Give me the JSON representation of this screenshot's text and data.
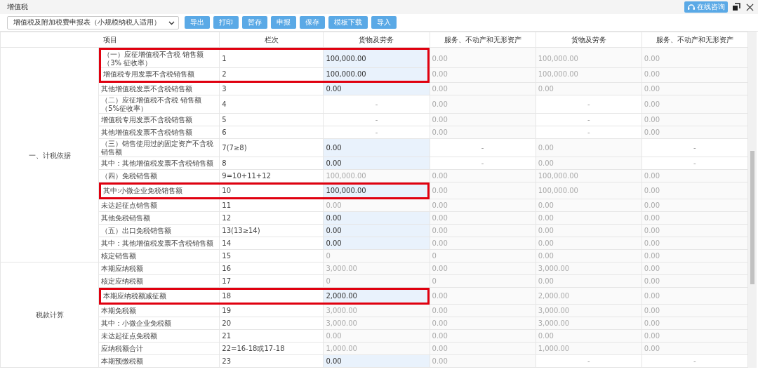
{
  "window": {
    "title": "增值税",
    "consult_button": "在线咨询"
  },
  "toolbar": {
    "report_select": {
      "value": "增值税及附加税费申报表（小规模纳税人适用）"
    },
    "buttons": [
      "导出",
      "打印",
      "暂存",
      "申报",
      "保存",
      "模板下载",
      "导入"
    ]
  },
  "table": {
    "columns": [
      "项目",
      "栏次",
      "货物及劳务",
      "服务、不动产和无形资产",
      "货物及劳务",
      "服务、不动产和无形资产"
    ],
    "sections": [
      {
        "label": "一、计税依据",
        "rows": [
          {
            "item": "（一）应征增值税不含税 销售额（3% 征收率）",
            "line": "1",
            "highlighted": true,
            "cells": [
              {
                "value": "100,000.00",
                "kind": "input"
              },
              {
                "value": "0.00",
                "kind": "readonly"
              },
              {
                "value": "100,000.00",
                "kind": "readonly"
              },
              {
                "value": "0.00",
                "kind": "readonly"
              }
            ]
          },
          {
            "item": "增值税专用发票不含税销售额",
            "line": "2",
            "highlighted": true,
            "cells": [
              {
                "value": "100,000.00",
                "kind": "input"
              },
              {
                "value": "0.00",
                "kind": "readonly"
              },
              {
                "value": "100,000.00",
                "kind": "readonly"
              },
              {
                "value": "0.00",
                "kind": "readonly"
              }
            ]
          },
          {
            "item": "其他增值税发票不含税销售额",
            "line": "3",
            "highlighted": false,
            "cells": [
              {
                "value": "0.00",
                "kind": "input"
              },
              {
                "value": "0.00",
                "kind": "readonly"
              },
              {
                "value": "0.00",
                "kind": "readonly"
              },
              {
                "value": "0.00",
                "kind": "readonly"
              }
            ]
          },
          {
            "item": "（二）应征增值税不含税 销售额（5%征收率）",
            "line": "4",
            "highlighted": false,
            "cells": [
              {
                "value": "-",
                "kind": "dash"
              },
              {
                "value": "0.00",
                "kind": "readonly"
              },
              {
                "value": "-",
                "kind": "dash"
              },
              {
                "value": "0.00",
                "kind": "readonly"
              }
            ]
          },
          {
            "item": "增值税专用发票不含税销售额",
            "line": "5",
            "highlighted": false,
            "cells": [
              {
                "value": "-",
                "kind": "dash"
              },
              {
                "value": "0.00",
                "kind": "readonly"
              },
              {
                "value": "-",
                "kind": "dash"
              },
              {
                "value": "0.00",
                "kind": "readonly"
              }
            ]
          },
          {
            "item": "其他增值税发票不含税销售额",
            "line": "6",
            "highlighted": false,
            "cells": [
              {
                "value": "-",
                "kind": "dash"
              },
              {
                "value": "0.00",
                "kind": "readonly"
              },
              {
                "value": "-",
                "kind": "dash"
              },
              {
                "value": "0.00",
                "kind": "readonly"
              }
            ]
          },
          {
            "item": "（三）销售使用过的固定资产不含税销售额",
            "line": "7(7≥8)",
            "highlighted": false,
            "cells": [
              {
                "value": "0.00",
                "kind": "input"
              },
              {
                "value": "-",
                "kind": "dash"
              },
              {
                "value": "0.00",
                "kind": "readonly"
              },
              {
                "value": "-",
                "kind": "dash"
              }
            ]
          },
          {
            "item": "其中：其他增值税发票不含税销售额",
            "line": "8",
            "highlighted": false,
            "cells": [
              {
                "value": "0.00",
                "kind": "input"
              },
              {
                "value": "-",
                "kind": "dash"
              },
              {
                "value": "0.00",
                "kind": "readonly"
              },
              {
                "value": "-",
                "kind": "dash"
              }
            ]
          },
          {
            "item": "（四）免税销售额",
            "line": "9=10+11+12",
            "highlighted": false,
            "cells": [
              {
                "value": "100,000.00",
                "kind": "readonly"
              },
              {
                "value": "0.00",
                "kind": "readonly"
              },
              {
                "value": "100,000.00",
                "kind": "readonly"
              },
              {
                "value": "0.00",
                "kind": "readonly"
              }
            ]
          },
          {
            "item": "其中:小微企业免税销售额",
            "line": "10",
            "highlighted": true,
            "cells": [
              {
                "value": "100,000.00",
                "kind": "input"
              },
              {
                "value": "0.00",
                "kind": "readonly"
              },
              {
                "value": "100,000.00",
                "kind": "readonly"
              },
              {
                "value": "0.00",
                "kind": "readonly"
              }
            ]
          },
          {
            "item": "未达起征点销售额",
            "line": "11",
            "highlighted": false,
            "cells": [
              {
                "value": "0.00",
                "kind": "readonly"
              },
              {
                "value": "0.00",
                "kind": "readonly"
              },
              {
                "value": "0.00",
                "kind": "readonly"
              },
              {
                "value": "0.00",
                "kind": "readonly"
              }
            ]
          },
          {
            "item": "其他免税销售额",
            "line": "12",
            "highlighted": false,
            "cells": [
              {
                "value": "0.00",
                "kind": "input"
              },
              {
                "value": "0.00",
                "kind": "readonly"
              },
              {
                "value": "0.00",
                "kind": "readonly"
              },
              {
                "value": "0.00",
                "kind": "readonly"
              }
            ]
          },
          {
            "item": "（五）出口免税销售额",
            "line": "13(13≥14)",
            "highlighted": false,
            "cells": [
              {
                "value": "0.00",
                "kind": "input"
              },
              {
                "value": "0.00",
                "kind": "readonly"
              },
              {
                "value": "0.00",
                "kind": "readonly"
              },
              {
                "value": "0.00",
                "kind": "readonly"
              }
            ]
          },
          {
            "item": "其中：其他增值税发票不含税销售额",
            "line": "14",
            "highlighted": false,
            "cells": [
              {
                "value": "0.00",
                "kind": "input"
              },
              {
                "value": "0.00",
                "kind": "readonly"
              },
              {
                "value": "0.00",
                "kind": "readonly"
              },
              {
                "value": "0.00",
                "kind": "readonly"
              }
            ]
          },
          {
            "item": "核定销售额",
            "line": "15",
            "highlighted": false,
            "cells": [
              {
                "value": "0",
                "kind": "readonly"
              },
              {
                "value": "0",
                "kind": "readonly"
              },
              {
                "value": "0.00",
                "kind": "readonly"
              },
              {
                "value": "0.00",
                "kind": "readonly"
              }
            ]
          }
        ]
      },
      {
        "label": "税款计算",
        "rows": [
          {
            "item": "本期应纳税额",
            "line": "16",
            "highlighted": false,
            "cells": [
              {
                "value": "3,000.00",
                "kind": "readonly"
              },
              {
                "value": "0.00",
                "kind": "readonly"
              },
              {
                "value": "3,000.00",
                "kind": "readonly"
              },
              {
                "value": "0.00",
                "kind": "readonly"
              }
            ]
          },
          {
            "item": "核定应纳税额",
            "line": "17",
            "highlighted": false,
            "cells": [
              {
                "value": "0",
                "kind": "readonly"
              },
              {
                "value": "0",
                "kind": "readonly"
              },
              {
                "value": "0.00",
                "kind": "readonly"
              },
              {
                "value": "0.00",
                "kind": "readonly"
              }
            ]
          },
          {
            "item": "本期应纳税额减征额",
            "line": "18",
            "highlighted": true,
            "cells": [
              {
                "value": "2,000.00",
                "kind": "input"
              },
              {
                "value": "0.00",
                "kind": "readonly"
              },
              {
                "value": "2,000.00",
                "kind": "readonly"
              },
              {
                "value": "0.00",
                "kind": "readonly"
              }
            ]
          },
          {
            "item": "本期免税额",
            "line": "19",
            "highlighted": false,
            "cells": [
              {
                "value": "3,000.00",
                "kind": "readonly"
              },
              {
                "value": "0.00",
                "kind": "readonly"
              },
              {
                "value": "3,000.00",
                "kind": "readonly"
              },
              {
                "value": "0.00",
                "kind": "readonly"
              }
            ]
          },
          {
            "item": "其中：小微企业免税额",
            "line": "20",
            "highlighted": false,
            "cells": [
              {
                "value": "3,000.00",
                "kind": "readonly"
              },
              {
                "value": "0.00",
                "kind": "readonly"
              },
              {
                "value": "3,000.00",
                "kind": "readonly"
              },
              {
                "value": "0.00",
                "kind": "readonly"
              }
            ]
          },
          {
            "item": "未达起征点免税额",
            "line": "21",
            "highlighted": false,
            "cells": [
              {
                "value": "0.00",
                "kind": "readonly"
              },
              {
                "value": "0.00",
                "kind": "readonly"
              },
              {
                "value": "0.00",
                "kind": "readonly"
              },
              {
                "value": "0.00",
                "kind": "readonly"
              }
            ]
          },
          {
            "item": "应纳税额合计",
            "line": "22=16-18或17-18",
            "highlighted": false,
            "cells": [
              {
                "value": "1,000.00",
                "kind": "readonly"
              },
              {
                "value": "0.00",
                "kind": "readonly"
              },
              {
                "value": "1,000.00",
                "kind": "readonly"
              },
              {
                "value": "0.00",
                "kind": "readonly"
              }
            ]
          },
          {
            "item": "本期预缴税额",
            "line": "23",
            "highlighted": false,
            "cells": [
              {
                "value": "0.00",
                "kind": "input"
              },
              {
                "value": "0.00",
                "kind": "readonly"
              },
              {
                "value": "-",
                "kind": "dash"
              },
              {
                "value": "-",
                "kind": "dash"
              }
            ]
          }
        ]
      }
    ]
  }
}
